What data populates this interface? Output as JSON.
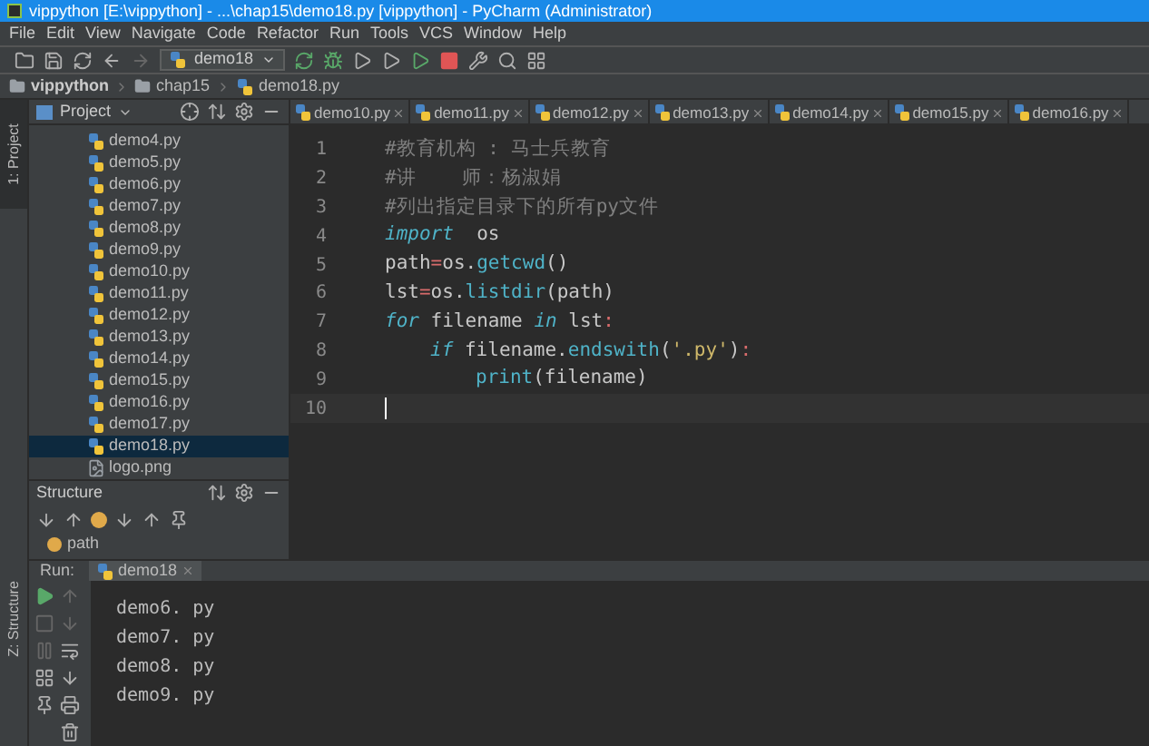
{
  "window": {
    "title": "vippython [E:\\vippython] - ...\\chap15\\demo18.py [vippython] - PyCharm (Administrator)"
  },
  "menu": [
    "File",
    "Edit",
    "View",
    "Navigate",
    "Code",
    "Refactor",
    "Run",
    "Tools",
    "VCS",
    "Window",
    "Help"
  ],
  "toolbar": {
    "run_config": "demo18"
  },
  "breadcrumb": [
    "vippython",
    "chap15",
    "demo18.py"
  ],
  "side_tabs": [
    "1: Project",
    "Z: Structure"
  ],
  "project": {
    "title": "Project",
    "files": [
      {
        "name": "demo4.py",
        "kind": "py",
        "selected": false
      },
      {
        "name": "demo5.py",
        "kind": "py",
        "selected": false
      },
      {
        "name": "demo6.py",
        "kind": "py",
        "selected": false
      },
      {
        "name": "demo7.py",
        "kind": "py",
        "selected": false
      },
      {
        "name": "demo8.py",
        "kind": "py",
        "selected": false
      },
      {
        "name": "demo9.py",
        "kind": "py",
        "selected": false
      },
      {
        "name": "demo10.py",
        "kind": "py",
        "selected": false
      },
      {
        "name": "demo11.py",
        "kind": "py",
        "selected": false
      },
      {
        "name": "demo12.py",
        "kind": "py",
        "selected": false
      },
      {
        "name": "demo13.py",
        "kind": "py",
        "selected": false
      },
      {
        "name": "demo14.py",
        "kind": "py",
        "selected": false
      },
      {
        "name": "demo15.py",
        "kind": "py",
        "selected": false
      },
      {
        "name": "demo16.py",
        "kind": "py",
        "selected": false
      },
      {
        "name": "demo17.py",
        "kind": "py",
        "selected": false
      },
      {
        "name": "demo18.py",
        "kind": "py",
        "selected": true
      },
      {
        "name": "logo.png",
        "kind": "png",
        "selected": false
      }
    ]
  },
  "structure": {
    "title": "Structure",
    "items": [
      "path"
    ]
  },
  "editor_tabs": [
    "demo10.py",
    "demo11.py",
    "demo12.py",
    "demo13.py",
    "demo14.py",
    "demo15.py",
    "demo16.py"
  ],
  "code": [
    {
      "number": "1",
      "current": false,
      "tokens": [
        {
          "kind": "comment",
          "text": "#教育机构 : 马士兵教育"
        }
      ]
    },
    {
      "number": "2",
      "current": false,
      "tokens": [
        {
          "kind": "comment",
          "text": "#讲    师：杨淑娟"
        }
      ]
    },
    {
      "number": "3",
      "current": false,
      "tokens": [
        {
          "kind": "comment",
          "text": "#列出指定目录下的所有py文件"
        }
      ]
    },
    {
      "number": "4",
      "current": false,
      "tokens": [
        {
          "kind": "keyword",
          "text": "import"
        },
        {
          "kind": "plain",
          "text": "  os"
        }
      ]
    },
    {
      "number": "5",
      "current": false,
      "tokens": [
        {
          "kind": "plain",
          "text": "path"
        },
        {
          "kind": "op",
          "text": "="
        },
        {
          "kind": "plain",
          "text": "os."
        },
        {
          "kind": "call",
          "text": "getcwd"
        },
        {
          "kind": "plain",
          "text": "()"
        }
      ]
    },
    {
      "number": "6",
      "current": false,
      "tokens": [
        {
          "kind": "plain",
          "text": "lst"
        },
        {
          "kind": "op",
          "text": "="
        },
        {
          "kind": "plain",
          "text": "os."
        },
        {
          "kind": "call",
          "text": "listdir"
        },
        {
          "kind": "plain",
          "text": "(path)"
        }
      ]
    },
    {
      "number": "7",
      "current": false,
      "tokens": [
        {
          "kind": "keyword",
          "text": "for"
        },
        {
          "kind": "plain",
          "text": " filename "
        },
        {
          "kind": "keyword",
          "text": "in"
        },
        {
          "kind": "plain",
          "text": " lst"
        },
        {
          "kind": "op",
          "text": ":"
        }
      ],
      "children": [
        {
          "number": "8",
          "current": false,
          "tokens": [
            {
              "kind": "keyword",
              "text": "if"
            },
            {
              "kind": "plain",
              "text": " filename."
            },
            {
              "kind": "call",
              "text": "endswith"
            },
            {
              "kind": "plain",
              "text": "("
            },
            {
              "kind": "string",
              "text": "'.py'"
            },
            {
              "kind": "plain",
              "text": ")"
            },
            {
              "kind": "op",
              "text": ":"
            }
          ],
          "children": [
            {
              "number": "9",
              "current": false,
              "tokens": [
                {
                  "kind": "call",
                  "text": "print"
                },
                {
                  "kind": "plain",
                  "text": "(filename)"
                }
              ]
            }
          ]
        }
      ]
    },
    {
      "number": "10",
      "current": true
    }
  ],
  "run": {
    "label": "Run:",
    "tab": "demo18",
    "output": [
      "demo6. py",
      "demo7. py",
      "demo8. py",
      "demo9. py"
    ]
  }
}
